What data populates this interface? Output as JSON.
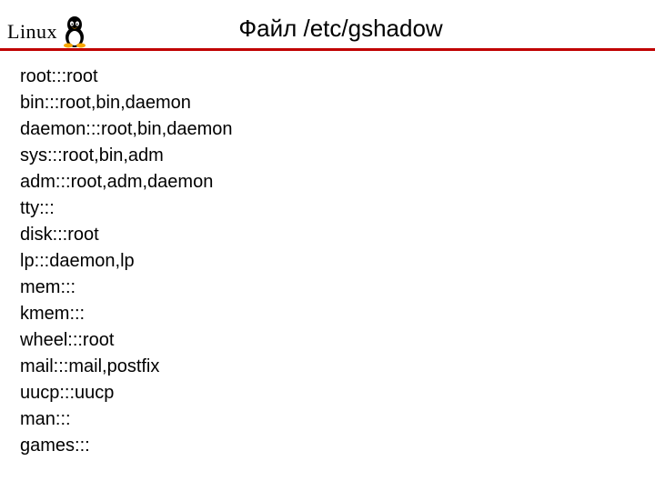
{
  "header": {
    "logo_text": "Linux",
    "title": "Файл /etc/gshadow"
  },
  "lines": [
    "root:::root",
    "bin:::root,bin,daemon",
    "daemon:::root,bin,daemon",
    "sys:::root,bin,adm",
    "adm:::root,adm,daemon",
    "tty:::",
    "disk:::root",
    "lp:::daemon,lp",
    "mem:::",
    "kmem:::",
    "wheel:::root",
    "mail:::mail,postfix",
    "uucp:::uucp",
    "man:::",
    "games:::"
  ]
}
